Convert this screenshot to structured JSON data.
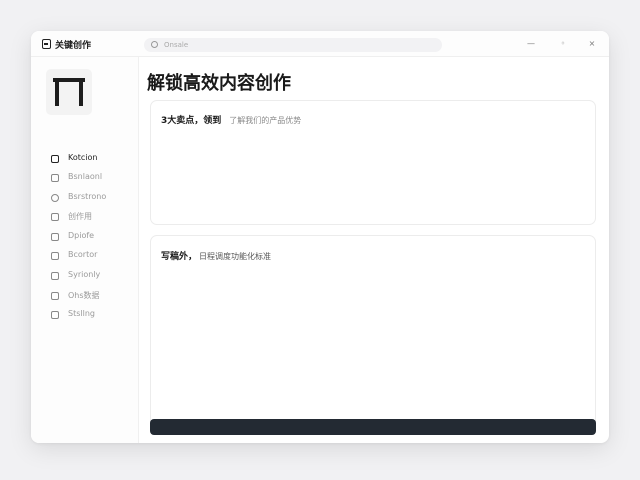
{
  "window": {
    "app_title": "关键创作",
    "search_placeholder": "Onsale",
    "controls": [
      "—",
      "◦",
      "×"
    ]
  },
  "sidebar": {
    "items": [
      {
        "label": "Kotcion",
        "icon": "document-icon",
        "active": true
      },
      {
        "label": "Bsnlaonl",
        "icon": "grid-icon",
        "active": false
      },
      {
        "label": "Bsrstrono",
        "icon": "clock-icon",
        "active": false
      },
      {
        "label": "创作用",
        "icon": "check-icon",
        "active": false
      },
      {
        "label": "Dpiofe",
        "icon": "tag-icon",
        "active": false
      },
      {
        "label": "Bcortor",
        "icon": "note-icon",
        "active": false
      },
      {
        "label": "Syrionly",
        "icon": "calendar-icon",
        "active": false
      },
      {
        "label": "Ohs数据",
        "icon": "chart-icon",
        "active": false
      },
      {
        "label": "Stsllng",
        "icon": "settings-icon",
        "active": false
      }
    ]
  },
  "main": {
    "title": "解锁高效内容创作",
    "card1": {
      "heading": "3大卖点，领到",
      "subtext": "了解我们的产品优势"
    },
    "card2": {
      "heading": "写稿外，",
      "subtext": "日程调度功能化标准"
    }
  }
}
